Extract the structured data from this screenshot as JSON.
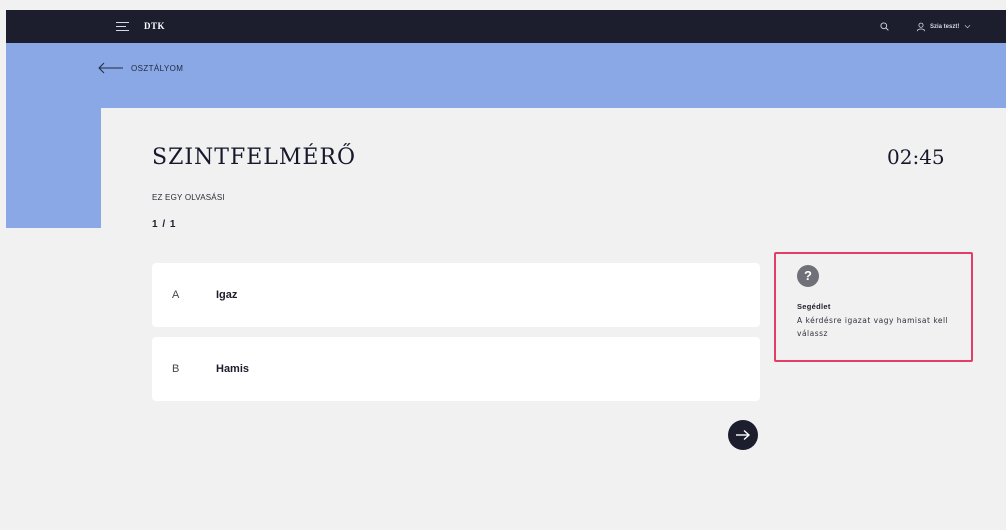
{
  "header": {
    "brand": "DTK",
    "user_name": "Szia teszt!",
    "icons": [
      "menu-icon",
      "search-icon",
      "user-icon",
      "chevron-down-icon"
    ]
  },
  "nav": {
    "back_label": "OSZTÁLYOM"
  },
  "quiz": {
    "title": "SZINTFELMÉRŐ",
    "timer": "02:45",
    "subtitle": "EZ EGY OLVASÁSI",
    "progress": "1 / 1",
    "answers": [
      {
        "letter": "A",
        "text": "Igaz"
      },
      {
        "letter": "B",
        "text": "Hamis"
      }
    ]
  },
  "help": {
    "icon": "?",
    "title": "Segédlet",
    "text": "A kérdésre igazat vagy hamisat kell válassz"
  },
  "colors": {
    "topbar": "#1c1d2d",
    "band": "#8ba8e6",
    "background": "#f1f1f1",
    "highlight": "#e23e68"
  }
}
